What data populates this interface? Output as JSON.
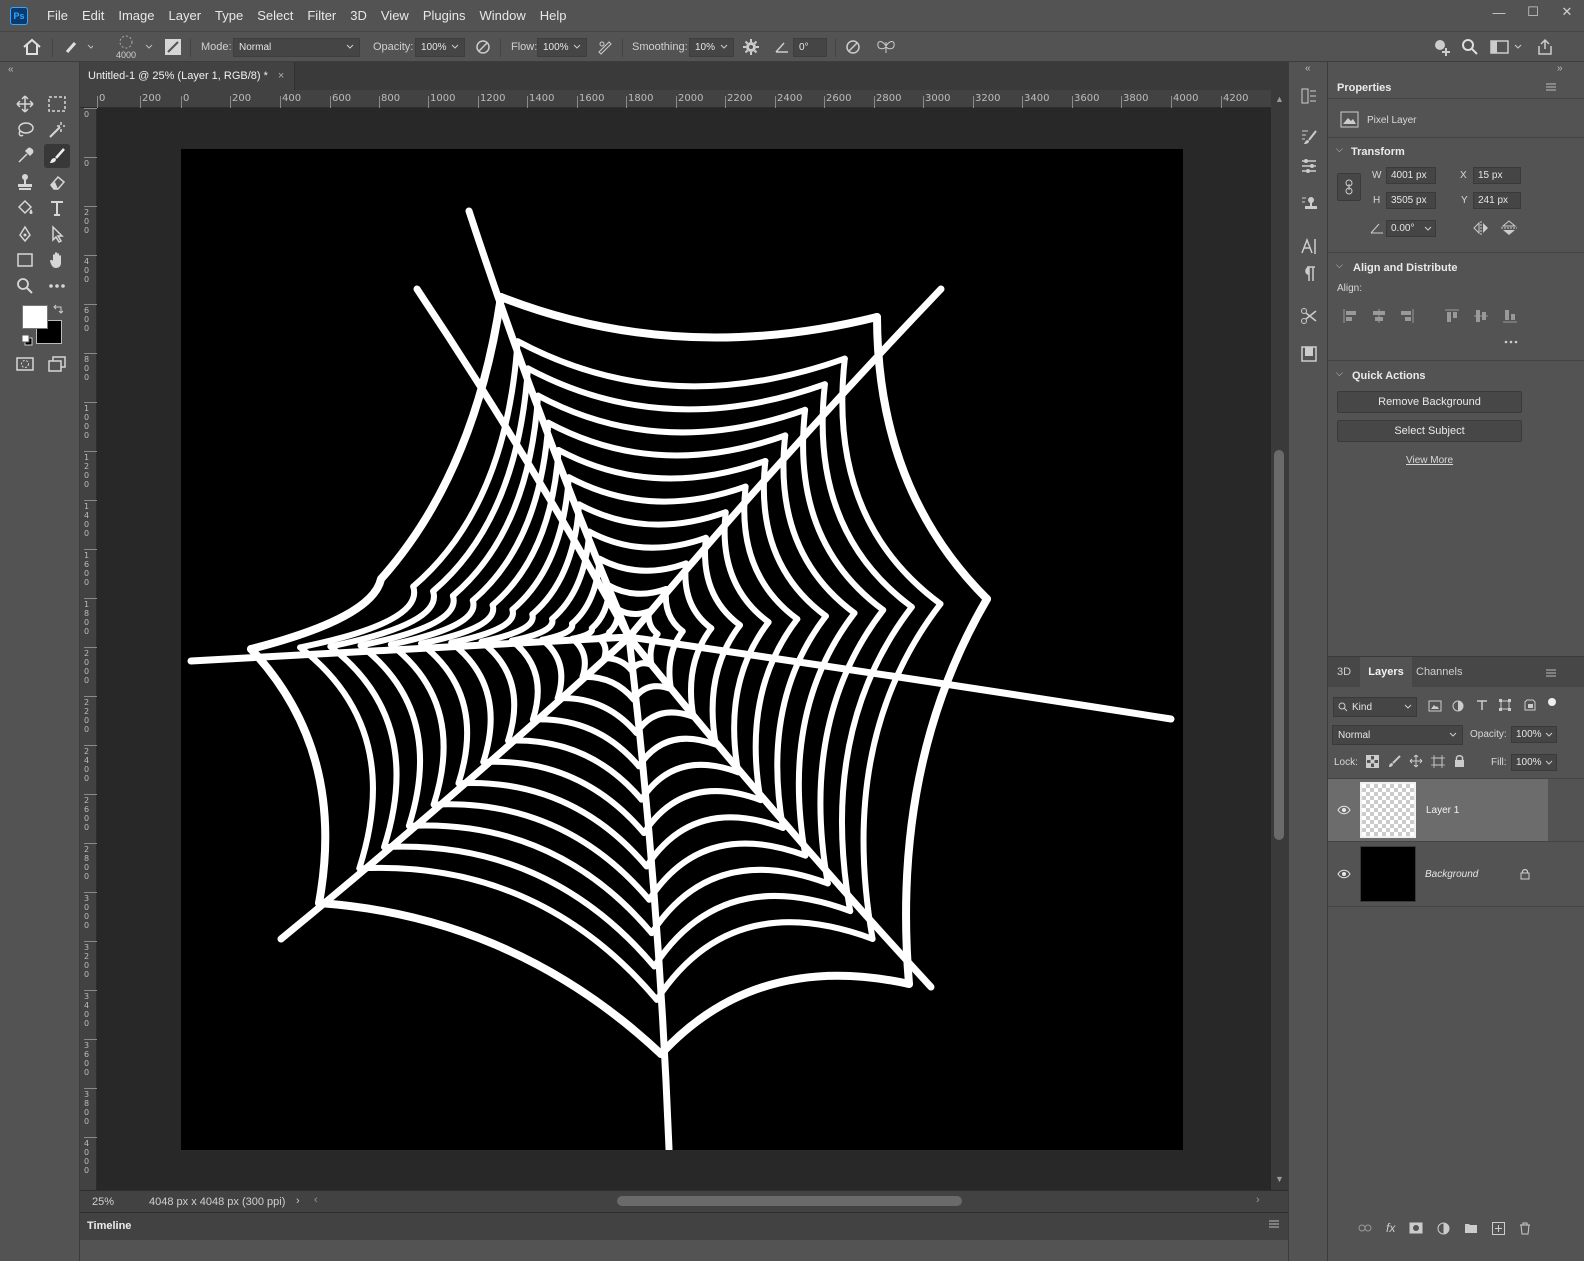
{
  "app": {
    "logo": "Ps"
  },
  "menu": [
    "File",
    "Edit",
    "Image",
    "Layer",
    "Type",
    "Select",
    "Filter",
    "3D",
    "View",
    "Plugins",
    "Window",
    "Help"
  ],
  "options": {
    "brush_size": "4000",
    "mode_label": "Mode:",
    "mode_value": "Normal",
    "opacity_label": "Opacity:",
    "opacity_value": "100%",
    "flow_label": "Flow:",
    "flow_value": "100%",
    "smoothing_label": "Smoothing:",
    "smoothing_value": "10%",
    "angle_value": "0°"
  },
  "document": {
    "tab_title": "Untitled-1 @ 25% (Layer 1, RGB/8) *",
    "zoom": "25%",
    "info": "4048 px x 4048 px (300 ppi)",
    "ruler_h": [
      "0",
      "200",
      "0",
      "200",
      "400",
      "600",
      "800",
      "1000",
      "1200",
      "1400",
      "1600",
      "1800",
      "2000",
      "2200",
      "2400",
      "2600",
      "2800",
      "3000",
      "3200",
      "3400",
      "3600",
      "3800",
      "4000",
      "4200"
    ],
    "ruler_v": [
      "0",
      "0",
      "2\n0\n0",
      "4\n0\n0",
      "6\n0\n0",
      "8\n0\n0",
      "1\n0\n0\n0",
      "1\n2\n0\n0",
      "1\n4\n0\n0",
      "1\n6\n0\n0",
      "1\n8\n0\n0",
      "2\n0\n0\n0",
      "2\n2\n0\n0",
      "2\n4\n0\n0",
      "2\n6\n0\n0",
      "2\n8\n0\n0",
      "3\n0\n0\n0",
      "3\n2\n0\n0",
      "3\n4\n0\n0",
      "3\n6\n0\n0",
      "3\n8\n0\n0",
      "4\n0\n0\n0",
      "4\n2\n0\n0"
    ],
    "canvas_bg": "#000000",
    "web_color": "#ffffff"
  },
  "timeline": {
    "label": "Timeline"
  },
  "properties": {
    "title": "Properties",
    "kind": "Pixel Layer",
    "transform": {
      "title": "Transform",
      "w_label": "W",
      "w_value": "4001 px",
      "h_label": "H",
      "h_value": "3505 px",
      "x_label": "X",
      "x_value": "15 px",
      "y_label": "Y",
      "y_value": "241 px",
      "angle_value": "0.00°"
    },
    "align": {
      "title": "Align and Distribute",
      "label": "Align:"
    },
    "quick_actions": {
      "title": "Quick Actions",
      "remove_bg": "Remove Background",
      "select_subject": "Select Subject",
      "view_more": "View More"
    }
  },
  "layers_panel": {
    "tabs": [
      "3D",
      "Layers",
      "Channels"
    ],
    "filter_kind": "Kind",
    "blend_mode": "Normal",
    "opacity_label": "Opacity:",
    "opacity_value": "100%",
    "lock_label": "Lock:",
    "fill_label": "Fill:",
    "fill_value": "100%",
    "layers": [
      {
        "name": "Layer 1",
        "selected": true,
        "visible": true
      },
      {
        "name": "Background",
        "selected": false,
        "visible": true,
        "locked": true
      }
    ]
  },
  "colors": {
    "accent": "#31a8ff",
    "foreground": "#ffffff",
    "background": "#000000"
  }
}
